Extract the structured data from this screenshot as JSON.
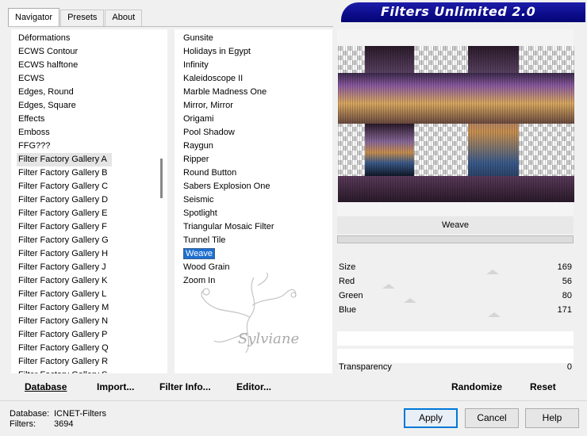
{
  "app_title": "Filters Unlimited 2.0",
  "tabs": [
    {
      "label": "Navigator"
    },
    {
      "label": "Presets"
    },
    {
      "label": "About"
    }
  ],
  "categories": [
    "Déformations",
    "ECWS Contour",
    "ECWS halftone",
    "ECWS",
    "Edges, Round",
    "Edges, Square",
    "Effects",
    "Emboss",
    "FFG???",
    "Filter Factory Gallery A",
    "Filter Factory Gallery B",
    "Filter Factory Gallery C",
    "Filter Factory Gallery D",
    "Filter Factory Gallery E",
    "Filter Factory Gallery F",
    "Filter Factory Gallery G",
    "Filter Factory Gallery H",
    "Filter Factory Gallery J",
    "Filter Factory Gallery K",
    "Filter Factory Gallery L",
    "Filter Factory Gallery M",
    "Filter Factory Gallery N",
    "Filter Factory Gallery P",
    "Filter Factory Gallery Q",
    "Filter Factory Gallery R",
    "Filter Factory Gallery S"
  ],
  "selected_category": "Filter Factory Gallery A",
  "filters": [
    "Gunsite",
    "Holidays in Egypt",
    "Infinity",
    "Kaleidoscope II",
    "Marble Madness One",
    "Mirror, Mirror",
    "Origami",
    "Pool Shadow",
    "Raygun",
    "Ripper",
    "Round Button",
    "Sabers Explosion One",
    "Seismic",
    "Spotlight",
    "Triangular Mosaic Filter",
    "Tunnel Tile",
    "Weave",
    "Wood Grain",
    "Zoom In"
  ],
  "selected_filter": "Weave",
  "watermark_text": "Sylviane",
  "preview": {
    "filter_name": "Weave"
  },
  "controls": [
    {
      "label": "Size",
      "value": "169"
    },
    {
      "label": "Red",
      "value": "56"
    },
    {
      "label": "Green",
      "value": "80"
    },
    {
      "label": "Blue",
      "value": "171"
    }
  ],
  "transparency": {
    "label": "Transparency",
    "value": "0"
  },
  "bottom_links": {
    "database": "Database",
    "import": "Import...",
    "filter_info": "Filter Info...",
    "editor": "Editor...",
    "randomize": "Randomize",
    "reset": "Reset"
  },
  "footer": {
    "database_label": "Database:",
    "database_value": "ICNET-Filters",
    "filters_label": "Filters:",
    "filters_value": "3694"
  },
  "buttons": {
    "apply": "Apply",
    "cancel": "Cancel",
    "help": "Help"
  },
  "colors": {
    "banner": "#0c0c8c",
    "selection": "#1e6fd0",
    "default_button_border": "#0078d7"
  }
}
